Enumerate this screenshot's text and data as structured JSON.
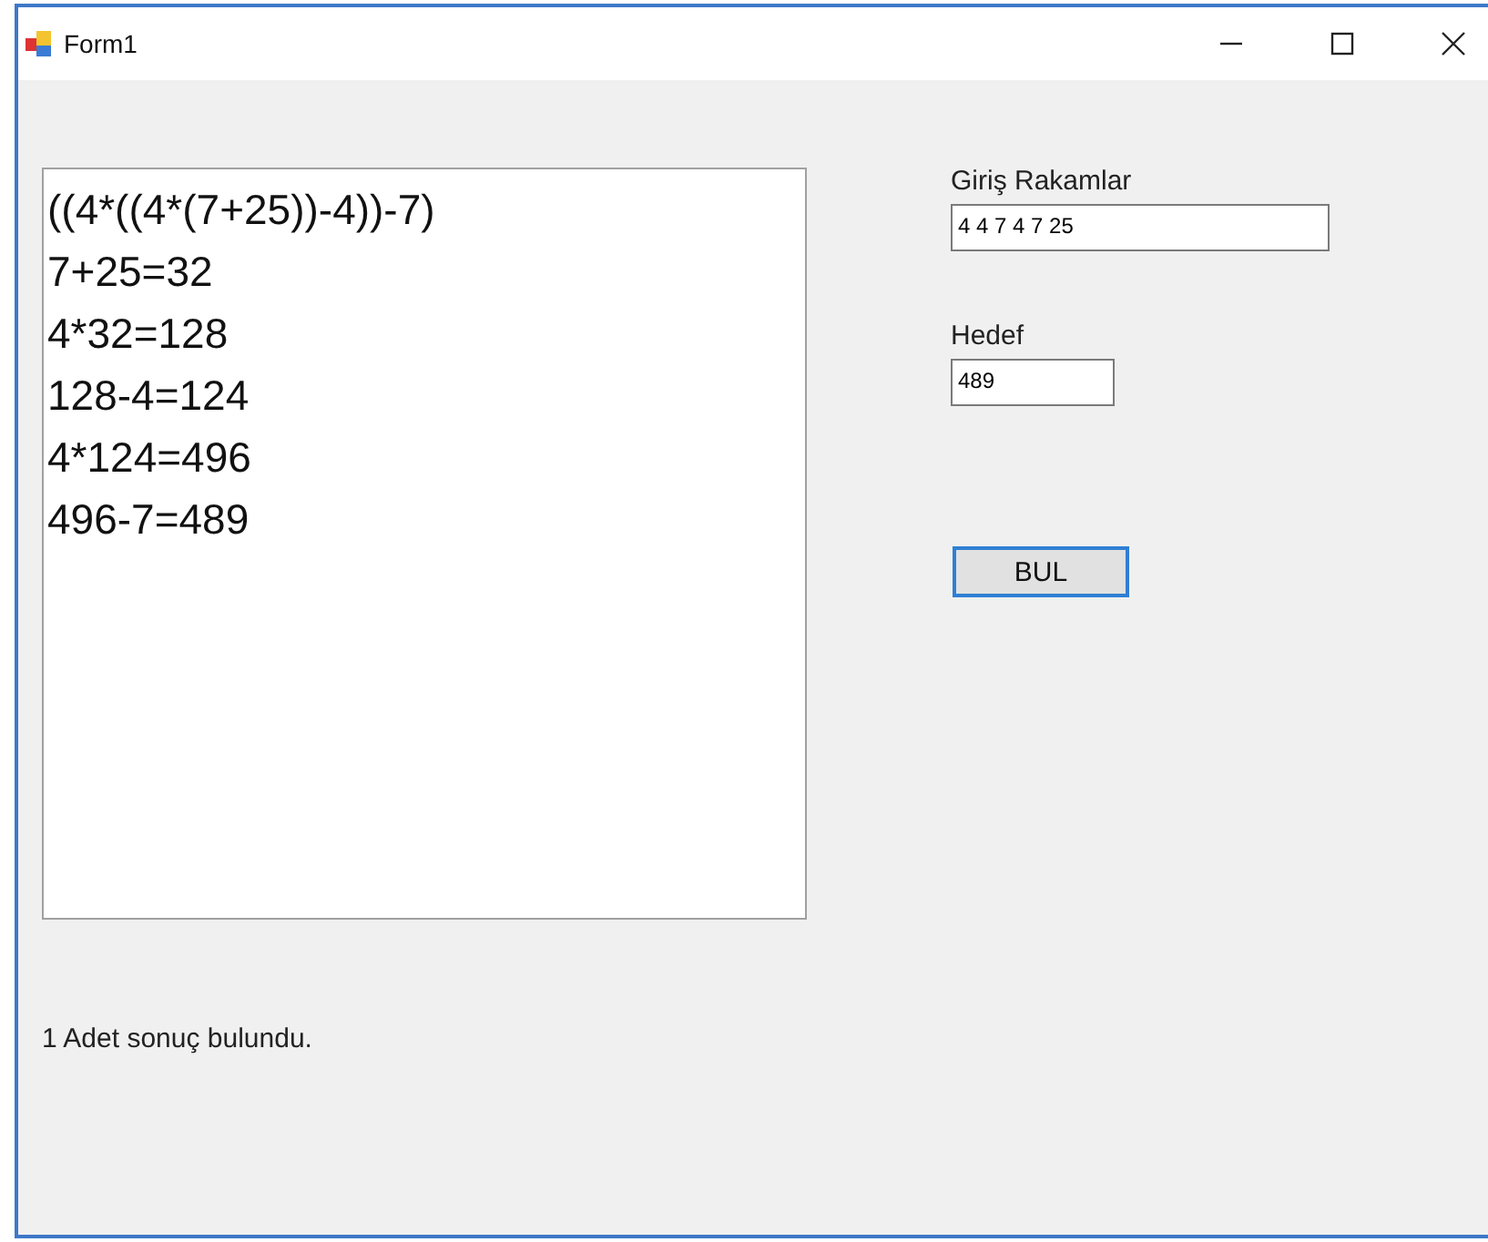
{
  "window": {
    "title": "Form1",
    "controls": [
      {
        "kind": "minimize"
      },
      {
        "kind": "maximize"
      },
      {
        "kind": "close"
      }
    ]
  },
  "result_list": {
    "lines": [
      "((4*((4*(7+25))-4))-7)",
      "7+25=32",
      "4*32=128",
      "128-4=124",
      "4*124=496",
      "496-7=489"
    ]
  },
  "digits": {
    "label": "Giriş Rakamlar",
    "value": "4 4 7 4 7 25"
  },
  "target": {
    "label": "Hedef",
    "value": "489"
  },
  "find_button": {
    "label": "BUL"
  },
  "status": "1 Adet sonuç bulundu."
}
